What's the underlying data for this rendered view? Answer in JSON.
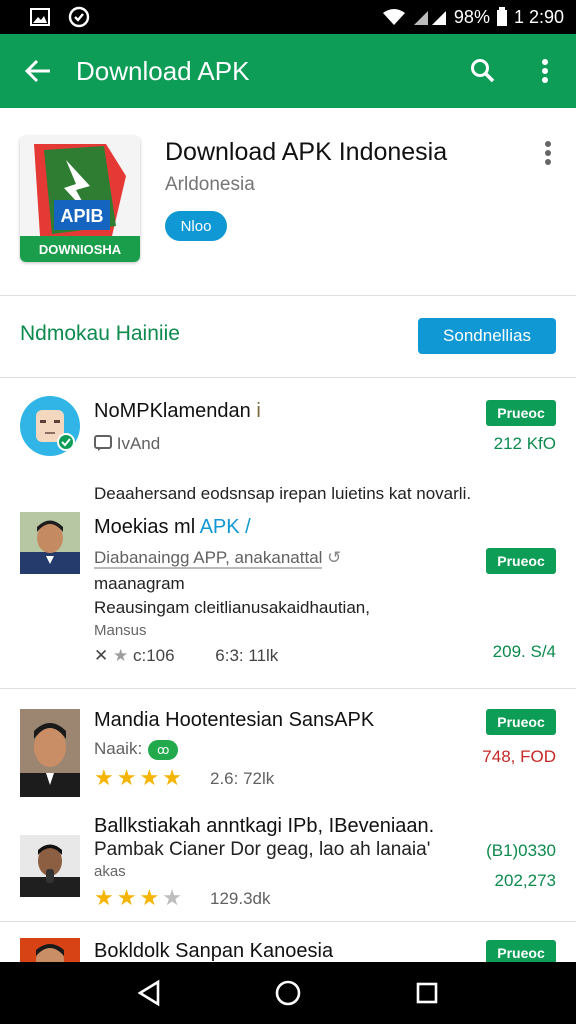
{
  "status_bar": {
    "battery": "98%",
    "time": "1 2:90",
    "icons": [
      "image-icon",
      "check-circle-icon",
      "wifi-icon",
      "signal-icon",
      "battery-icon"
    ]
  },
  "app_bar": {
    "title": "Download APK",
    "icons": [
      "back-arrow-icon",
      "search-icon",
      "more-vert-icon"
    ],
    "color": "#0d9d57"
  },
  "header": {
    "title": "Download APK Indonesia",
    "subtitle": "Arldonesia",
    "badge": "Nloo",
    "icon_top_text": "APIB",
    "icon_bottom_text": "DOWNIOSHA"
  },
  "section": {
    "title": "Ndmokau Hainiie",
    "button": "Sondnellias"
  },
  "items": [
    {
      "title": "NoMPKlamendan",
      "title_suffix": "i",
      "subtitle": "IvAnd",
      "chip": "Prueoc",
      "value": "212 KfO"
    },
    {
      "intro": "Deaahersand eodsnsap irepan luietins kat novarli.",
      "title": "Moekias ml",
      "title_link": "APK /",
      "subtitle": "Diabanaingg APP, anakanattal",
      "line2": "maanagram",
      "desc": "Reausingam cleitlianusakaidhautian,",
      "small": "Mansus",
      "meta_left": "c:106",
      "meta_size": "6:3: 11lk",
      "chip": "Prueoc",
      "value": "209. S/4"
    },
    {
      "title": "Mandia Hootentesian SansAPK",
      "subtitle": "Naaik:",
      "tag": "ꝏ",
      "stars": 4,
      "rating": "2.6: 72lk",
      "chip": "Prueoc",
      "value": "748, FOD"
    },
    {
      "title": "Ballkstiakah anntkagi IPb, IBeveniaan.",
      "desc": "Pambak Cianer Dor geag, lao ah lanaia'",
      "small": "akas",
      "stars": 3,
      "rating": "129.3dk",
      "value_top": "(B1)0330",
      "value": "202,273"
    },
    {
      "title": "Bokldolk Sanpan Kanoesia",
      "chip": "Prueoc"
    }
  ],
  "colors": {
    "accent": "#0d9d57",
    "blue": "#0f98d4",
    "star": "#f5b400",
    "price_red": "#c62828"
  },
  "nav": [
    "back-triangle-icon",
    "home-circle-icon",
    "recents-square-icon"
  ]
}
